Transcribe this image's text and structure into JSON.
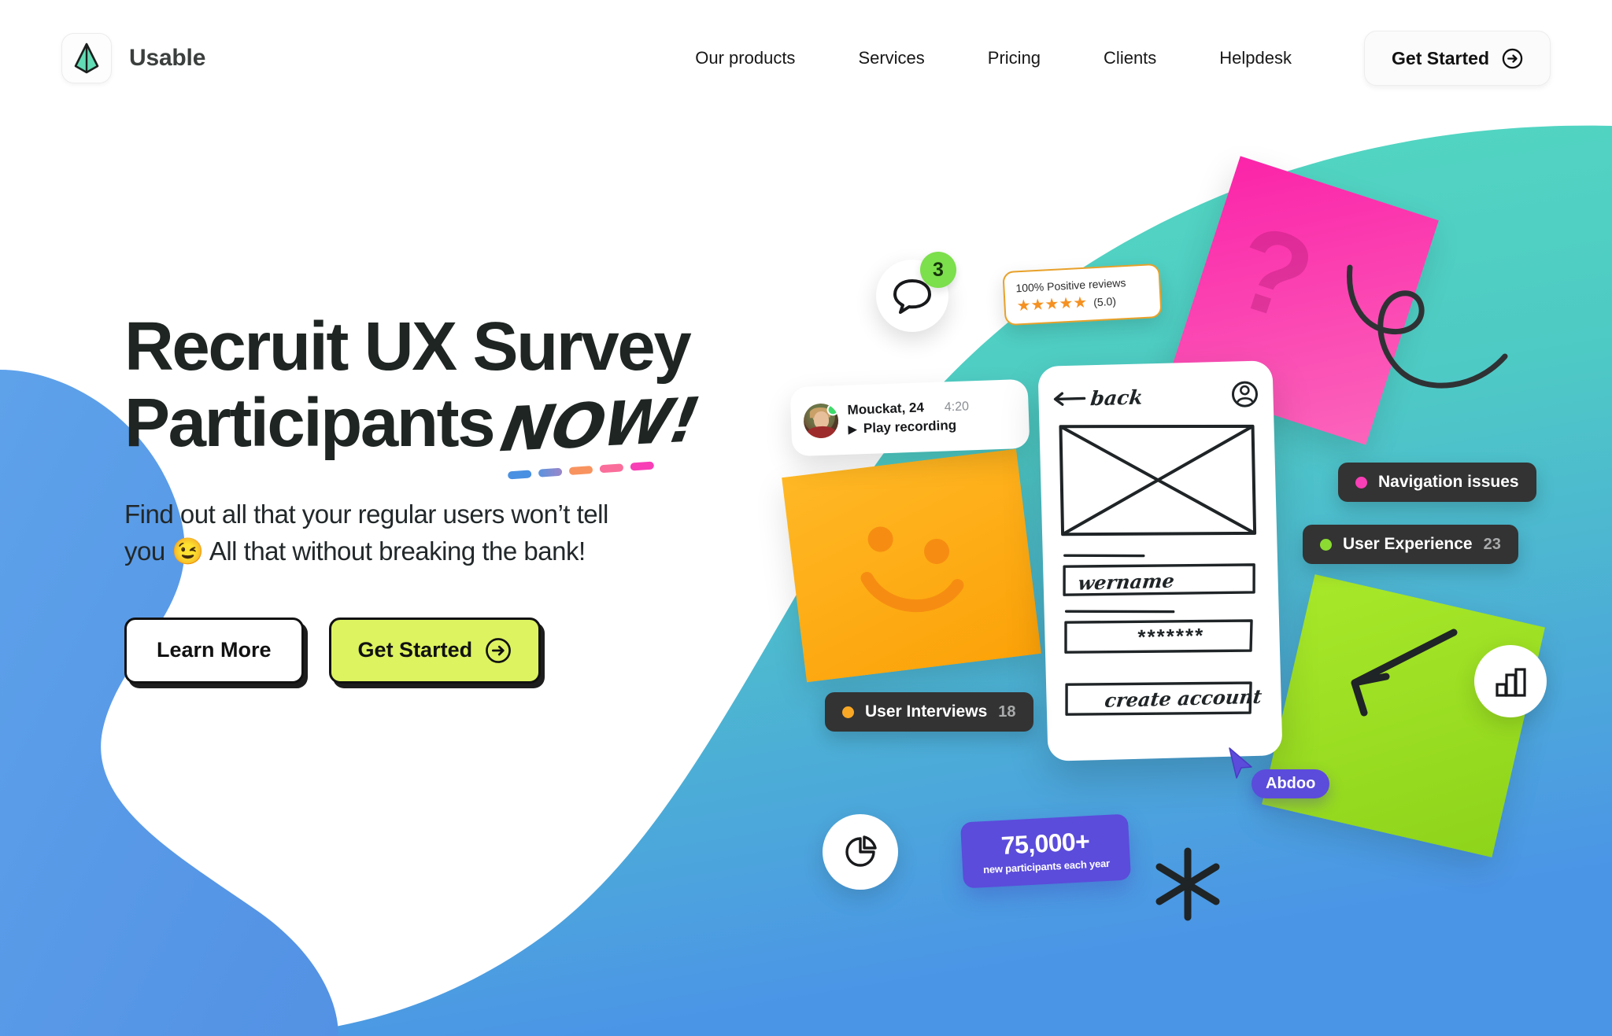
{
  "brand": {
    "name": "Usable",
    "logo_icon": "pyramid-logo-icon",
    "logo_color": "#5fd9b0"
  },
  "nav": {
    "items": [
      {
        "label": "Our products"
      },
      {
        "label": "Services"
      },
      {
        "label": "Pricing"
      },
      {
        "label": "Clients"
      },
      {
        "label": "Helpdesk"
      }
    ],
    "cta": {
      "label": "Get Started",
      "icon": "arrow-right-circle-icon"
    }
  },
  "hero": {
    "headline_line1": "Recruit UX Survey",
    "headline_line2": "Participants",
    "headline_accent": "NOW!",
    "accent_dash_colors": [
      "#4a90e2",
      "#7f8ad6",
      "#f8935f",
      "#fa6e9b",
      "#f83fb6"
    ],
    "subhead_line1": "Find out all that your regular users won’t tell",
    "subhead_line2_pre": "you ",
    "subhead_emoji": "😉",
    "subhead_line2_post": " All that without breaking the bank!",
    "buttons": {
      "secondary": {
        "label": "Learn More"
      },
      "primary": {
        "label": "Get Started",
        "icon": "arrow-right-circle-icon",
        "color": "#ddf360"
      }
    }
  },
  "collage": {
    "chat_badge_count": "3",
    "review_card": {
      "title": "100% Positive reviews",
      "stars": "★★★★★",
      "score": "(5.0)",
      "border_color": "#e8a12a"
    },
    "recording_card": {
      "name": "Mouckat, 24",
      "time": "4:20",
      "play_glyph": "▶",
      "action": "Play recording",
      "status_color": "#3ddc6a"
    },
    "wireframe": {
      "back_label": "back",
      "back_arrow": "←",
      "account_icon": "user-circle-icon",
      "field_username": "wername",
      "field_password": "*******",
      "submit_label": "create account"
    },
    "tags": [
      {
        "label": "Navigation issues",
        "dot_color": "#f83fb6",
        "count": ""
      },
      {
        "label": "User Experience",
        "dot_color": "#8bdb33",
        "count": "23"
      },
      {
        "label": "User Interviews",
        "dot_color": "#f9a825",
        "count": "18"
      }
    ],
    "stat_card": {
      "value": "75,000+",
      "caption": "new participants each year",
      "color": "#5b4cdb"
    },
    "cursor": {
      "label": "Abdoo",
      "color": "#5b4cdb"
    },
    "icons": {
      "pie": "pie-chart-icon",
      "bars": "bar-chart-icon",
      "chat": "chat-bubble-icon",
      "asterisk": "asterisk-icon",
      "squiggle": "loop-squiggle-icon"
    },
    "sticky_notes": [
      {
        "name": "question-note",
        "color": "#fb24a9",
        "glyph": "?"
      },
      {
        "name": "smiley-note",
        "color": "#fca208",
        "glyph": "smiley"
      },
      {
        "name": "green-note",
        "color": "#8ed41b",
        "glyph": "arrow"
      }
    ]
  },
  "background": {
    "blue": "#5b9be8",
    "teal": "#4fd1bd",
    "mint": "#5fdcc2"
  }
}
